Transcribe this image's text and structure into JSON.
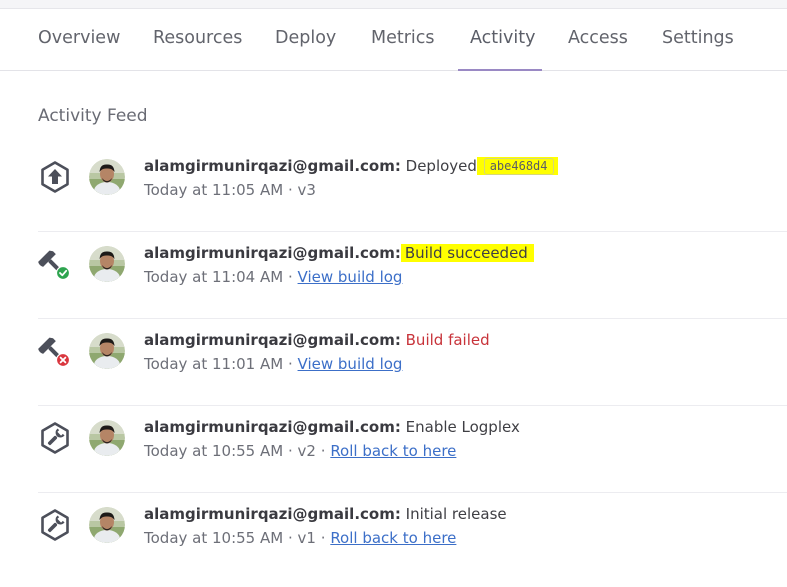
{
  "tabs": [
    {
      "label": "Overview"
    },
    {
      "label": "Resources"
    },
    {
      "label": "Deploy"
    },
    {
      "label": "Metrics"
    },
    {
      "label": "Activity"
    },
    {
      "label": "Access"
    },
    {
      "label": "Settings"
    }
  ],
  "activity_feed": {
    "title": "Activity Feed",
    "items": [
      {
        "icon": "deploy-upload-icon",
        "user": "alamgirmunirqazi@gmail.com:",
        "action": "Deployed",
        "commit": "abe468d4",
        "time": "Today at 11:05 AM",
        "sep": "·",
        "meta": "v3"
      },
      {
        "icon": "build-success-hammer-icon",
        "user": "alamgirmunirqazi@gmail.com:",
        "action": "Build succeeded",
        "time": "Today at 11:04 AM",
        "sep": "·",
        "link": "View build log"
      },
      {
        "icon": "build-failed-hammer-icon",
        "user": "alamgirmunirqazi@gmail.com:",
        "action": "Build failed",
        "time": "Today at 11:01 AM",
        "sep": "·",
        "link": "View build log"
      },
      {
        "icon": "wrench-icon",
        "user": "alamgirmunirqazi@gmail.com:",
        "action": "Enable Logplex",
        "time": "Today at 10:55 AM",
        "sep": "·",
        "meta": "v2",
        "sep2": "·",
        "link": "Roll back to here"
      },
      {
        "icon": "wrench-icon",
        "user": "alamgirmunirqazi@gmail.com:",
        "action": "Initial release",
        "time": "Today at 10:55 AM",
        "sep": "·",
        "meta": "v1",
        "sep2": "·",
        "link": "Roll back to here"
      }
    ]
  },
  "colors": {
    "highlight": "#ffff00",
    "failed": "#c8333a",
    "link": "#3c6fc8",
    "success": "#2ea44f",
    "icon": "#4c4f5a"
  }
}
